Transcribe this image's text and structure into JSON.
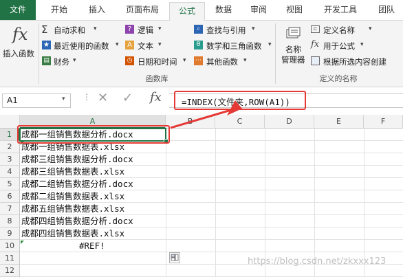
{
  "tabs": [
    {
      "label": "文件"
    },
    {
      "label": "开始"
    },
    {
      "label": "插入"
    },
    {
      "label": "页面布局"
    },
    {
      "label": "公式"
    },
    {
      "label": "数据"
    },
    {
      "label": "审阅"
    },
    {
      "label": "视图"
    },
    {
      "label": "开发工具"
    },
    {
      "label": "团队"
    }
  ],
  "ribbon": {
    "insert_function": "插入函数",
    "library": {
      "autosum": "自动求和",
      "recent": "最近使用的函数",
      "financial": "财务",
      "logical": "逻辑",
      "text": "文本",
      "datetime": "日期和时间",
      "lookup": "查找与引用",
      "math": "数学和三角函数",
      "other": "其他函数",
      "group_label": "函数库"
    },
    "names": {
      "name_manager_line1": "名称",
      "name_manager_line2": "管理器",
      "define_name": "定义名称",
      "use_in_formula": "用于公式",
      "create_from_selection": "根据所选内容创建",
      "group_label": "定义的名称"
    }
  },
  "formula_bar": {
    "name_box": "A1",
    "fx": "fx",
    "formula": "=INDEX(文件夹,ROW(A1))"
  },
  "grid": {
    "columns": [
      "A",
      "B",
      "C",
      "D",
      "E",
      "F"
    ],
    "rows": [
      {
        "num": "1",
        "a": "成都一组销售数据分析.docx"
      },
      {
        "num": "2",
        "a": "成都一组销售数据表.xlsx"
      },
      {
        "num": "3",
        "a": "成都三组销售数据分析.docx"
      },
      {
        "num": "4",
        "a": "成都三组销售数据表.xlsx"
      },
      {
        "num": "5",
        "a": "成都二组销售数据分析.docx"
      },
      {
        "num": "6",
        "a": "成都二组销售数据表.xlsx"
      },
      {
        "num": "7",
        "a": "成都五组销售数据表.xlsx"
      },
      {
        "num": "8",
        "a": "成都四组销售数据分析.docx"
      },
      {
        "num": "9",
        "a": "成都四组销售数据表.xlsx"
      },
      {
        "num": "10",
        "a": "#REF!"
      },
      {
        "num": "11",
        "a": ""
      },
      {
        "num": "12",
        "a": ""
      }
    ]
  },
  "watermark": "https://blog.csdn.net/zkxxx123",
  "colors": {
    "accent": "#217346",
    "highlight": "#e53935"
  }
}
